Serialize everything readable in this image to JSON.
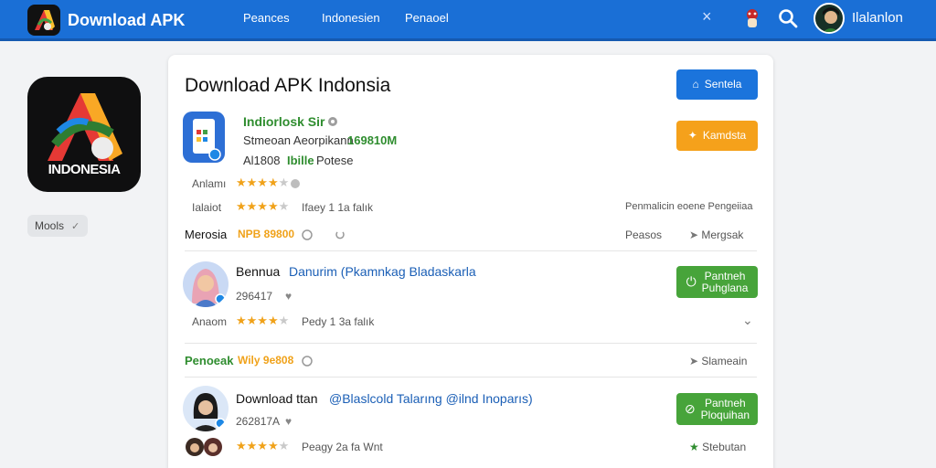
{
  "header": {
    "title": "Download APK",
    "nav": [
      "Peances",
      "Indonesien",
      "Penaoel"
    ],
    "user_name": "Ilalanlon"
  },
  "sidebar": {
    "icon_text": "INDONESIA",
    "chip_label": "Mools"
  },
  "card": {
    "title": "Download APK Indonsia",
    "btn_primary": "Sentela",
    "btn_secondary": "Kamdsta"
  },
  "apps": [
    {
      "name": "Indiorlosk Sir",
      "subtitle": "Stmeoan Aeorpikann",
      "size": "169810M",
      "meta_a": "Al1808",
      "meta_green": "Ibille",
      "meta_b": "Potese",
      "rating_label": "Anlamı",
      "rating_stars": 4,
      "row2_label": "Ialaiot",
      "row2_stars": 4,
      "row2_text": "Ifaey 1 1a falık",
      "row2_right": "Penmalicin eoene Pengeiiaa",
      "footer_left": "Merosia",
      "footer_orange": "NPB 89800",
      "footer_mid": "Peasos",
      "footer_right": "Mergsak"
    },
    {
      "title_dark": "Bennua",
      "title_blue": "Danurim (Pkamnkag Bladaskarla",
      "sub": "296417",
      "rating_label": "Anaom",
      "rating_stars": 4,
      "rating_text": "Pedy 1 3a falık",
      "footer_left": "Penoeak",
      "footer_orange": "Wily 9e808",
      "footer_right": "Slameain",
      "btn_line1": "Pantneh",
      "btn_line2": "Puhglana"
    },
    {
      "title_dark": "Download ttan",
      "title_blue": "@Blaslcold Talarıng @ilnd Inoparıs)",
      "sub": "262817A",
      "rating_stars": 4,
      "rating_text": "Peagy 2a fa Wnt",
      "footer_right": "Stebutan",
      "btn_line1": "Pantneh",
      "btn_line2": "Ploquihan"
    }
  ],
  "colors": {
    "header": "#1a6fd6",
    "blue_button": "#1b74dc",
    "orange_button": "#f5a11b",
    "green_button": "#47a43a",
    "star": "#f0a21a"
  }
}
